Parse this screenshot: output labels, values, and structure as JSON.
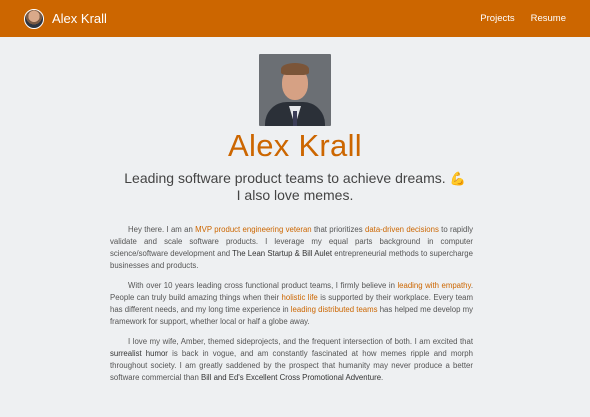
{
  "navbar": {
    "brand_name": "Alex Krall",
    "links": [
      "Projects",
      "Resume"
    ]
  },
  "hero": {
    "name": "Alex Krall",
    "tagline_line1": "Leading software product teams to achieve dreams.",
    "tagline_emoji": "💪",
    "tagline_line2": "I also love memes."
  },
  "bio": {
    "p1": [
      {
        "t": "Hey there. I am an ",
        "s": "text"
      },
      {
        "t": "MVP product engineering veteran",
        "s": "accent"
      },
      {
        "t": " that prioritizes ",
        "s": "text"
      },
      {
        "t": "data-driven decisions",
        "s": "accent"
      },
      {
        "t": " to rapidly validate and scale software products. I leverage my equal parts background in computer science/software development and ",
        "s": "text"
      },
      {
        "t": "The Lean Startup & Bill Aulet",
        "s": "strong"
      },
      {
        "t": " entrepreneurial methods to supercharge businesses and products.",
        "s": "text"
      }
    ],
    "p2": [
      {
        "t": "With over 10 years leading cross functional product teams, I firmly believe in ",
        "s": "text"
      },
      {
        "t": "leading with empathy",
        "s": "accent"
      },
      {
        "t": ". People can truly build amazing things when their ",
        "s": "text"
      },
      {
        "t": "holistic life",
        "s": "accent"
      },
      {
        "t": " is supported by their workplace. Every team has different needs, and my long time experience in ",
        "s": "text"
      },
      {
        "t": "leading distributed teams",
        "s": "accent"
      },
      {
        "t": " has helped me develop my framework for support, whether local or half a globe away.",
        "s": "text"
      }
    ],
    "p3": [
      {
        "t": "I love my wife, Amber, themed sideprojects, and the frequent intersection of both. I am excited that ",
        "s": "text"
      },
      {
        "t": "surrealist humor",
        "s": "strong"
      },
      {
        "t": " is back in vogue, and am constantly fascinated at how memes ripple and morph throughout society. I am greatly saddened by the prospect that humanity may never produce a better software commercial than ",
        "s": "text"
      },
      {
        "t": "Bill and Ed's Excellent Cross Promotional Adventure",
        "s": "strong"
      },
      {
        "t": ".",
        "s": "text"
      }
    ]
  },
  "colors": {
    "accent": "#cc6600",
    "background": "#eef0f2",
    "text": "#555555"
  }
}
